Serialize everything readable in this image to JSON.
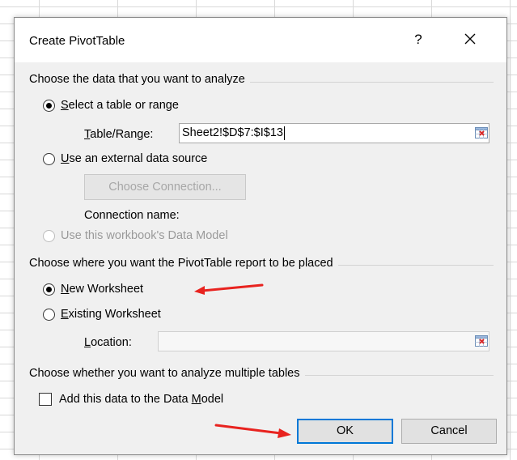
{
  "dialog": {
    "title": "Create PivotTable",
    "help_label": "?",
    "close_icon": "close-icon"
  },
  "section_data": {
    "label": "Choose the data that you want to analyze",
    "select_range": {
      "accel": "S",
      "rest": "elect a table or range",
      "checked": true
    },
    "table_range": {
      "accel": "T",
      "rest": "able/Range:",
      "value": "Sheet2!$D$7:$I$13"
    },
    "external": {
      "accel": "U",
      "rest": "se an external data source",
      "checked": false
    },
    "choose_connection": "Choose Connection...",
    "connection_name": "Connection name:",
    "data_model": {
      "label": "Use this workbook's Data Model",
      "enabled": false
    }
  },
  "section_placement": {
    "label": "Choose where you want the PivotTable report to be placed",
    "new_worksheet": {
      "accel": "N",
      "rest": "ew Worksheet",
      "checked": true
    },
    "existing_worksheet": {
      "accel": "E",
      "rest": "xisting Worksheet",
      "checked": false
    },
    "location": {
      "accel": "L",
      "rest": "ocation:",
      "value": ""
    }
  },
  "section_multiple": {
    "label": "Choose whether you want to analyze multiple tables",
    "add_to_model": {
      "pre": "Add this data to the Data ",
      "accel": "M",
      "rest": "odel",
      "checked": false
    }
  },
  "buttons": {
    "ok": "OK",
    "cancel": "Cancel"
  },
  "colors": {
    "accent": "#0078d7",
    "annotation_arrow": "#e8231f",
    "dialog_bg": "#f0f0f0"
  },
  "icons": {
    "range_selector": "range-selector-icon",
    "annotation": "red-arrow-icon"
  }
}
